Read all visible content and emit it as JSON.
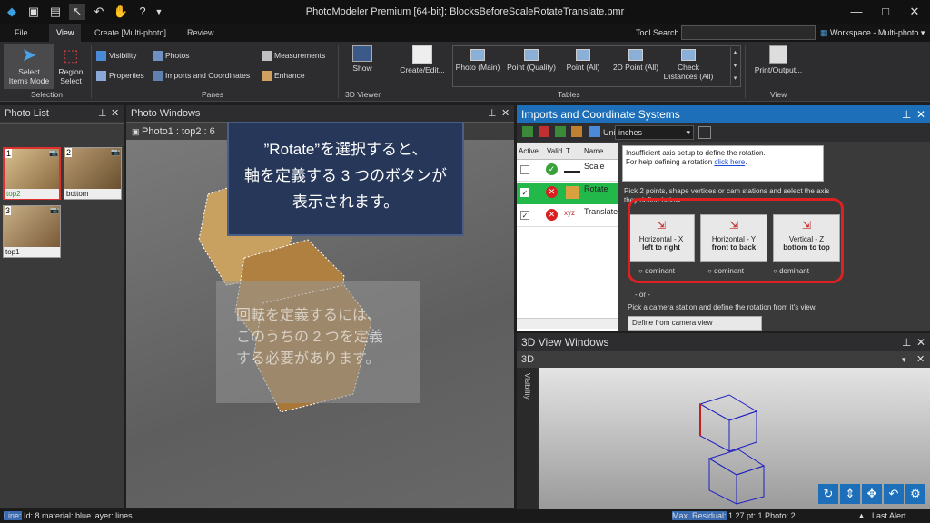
{
  "app": {
    "title": "PhotoModeler Premium [64-bit]: BlocksBeforeScaleRotateTranslate.pmr"
  },
  "menu": {
    "tabs": [
      "File",
      "View",
      "Create [Multi-photo]",
      "Review"
    ],
    "tool_search": "Tool Search",
    "workspace": "Workspace - Multi-photo"
  },
  "ribbon": {
    "select_items_mode": "Select\nItems Mode",
    "region_select": "Region\nSelect",
    "selection_group": "Selection",
    "visibility": "Visibility",
    "properties": "Properties",
    "photos": "Photos",
    "imports_coords": "Imports and Coordinates",
    "measurements": "Measurements",
    "enhance": "Enhance",
    "panes_group": "Panes",
    "show": "Show",
    "viewer_group": "3D Viewer",
    "create_edit": "Create/Edit...",
    "photo_main": "Photo (Main)",
    "point_quality": "Point (Quality)",
    "point_all": "Point (All)",
    "point_2d_all": "2D Point (All)",
    "check_distances": "Check\nDistances (All)",
    "tables_group": "Tables",
    "print_output": "Print/Output...",
    "view_group": "View"
  },
  "photo_list": {
    "title": "Photo List",
    "photos": [
      {
        "num": "1",
        "name": "top2"
      },
      {
        "num": "2",
        "name": "bottom"
      },
      {
        "num": "3",
        "name": "top1"
      }
    ]
  },
  "photo_windows": {
    "title": "Photo Windows",
    "tab": "Photo1 : top2 : 6"
  },
  "callout": {
    "line1": "”Rotate”を選択すると、",
    "line2": "軸を定義する 3 つのボタンが",
    "line3": "表示されます。"
  },
  "faded_note": {
    "line1": "回転を定義するには、",
    "line2": "このうちの 2 つを定義",
    "line3": "する必要があります。"
  },
  "imports": {
    "title": "Imports and Coordinate Systems",
    "units_label": "Units:",
    "units_value": "inches",
    "columns": [
      "Active",
      "Valid",
      "T...",
      "Name"
    ],
    "rows": [
      {
        "name": "Scale"
      },
      {
        "name": "Rotate"
      },
      {
        "name": "Translate"
      }
    ],
    "info_line1": "Insufficient axis setup to define the rotation.",
    "info_line2": "For help defining a rotation ",
    "info_link": "click here",
    "pick_text": "Pick 2 points, shape vertices or cam stations and select the axis they define below..",
    "buttons": [
      {
        "line1": "Horizontal - X",
        "line2": "left to right"
      },
      {
        "line1": "Horizontal - Y",
        "line2": "front to back"
      },
      {
        "line1": "Vertical - Z",
        "line2": "bottom to top"
      }
    ],
    "dominant": "dominant",
    "or_text": "- or -",
    "camera_text": "Pick a camera station and define the rotation from it's view.",
    "define_cam": "Define from camera view"
  },
  "view3d": {
    "title": "3D View Windows",
    "tab": "3D",
    "side": "Visibility"
  },
  "status": {
    "line_label": "Line:",
    "line_text": " Id: 8 material: blue layer: lines",
    "residual_label": "Max. Residual:",
    "residual_text": " 1.27 pt: 1 Photo: 2",
    "alert": "Last Alert"
  },
  "colors": {
    "accent": "#1c6fb8",
    "highlight_red": "#e02020",
    "callout_bg": "#26375a"
  }
}
